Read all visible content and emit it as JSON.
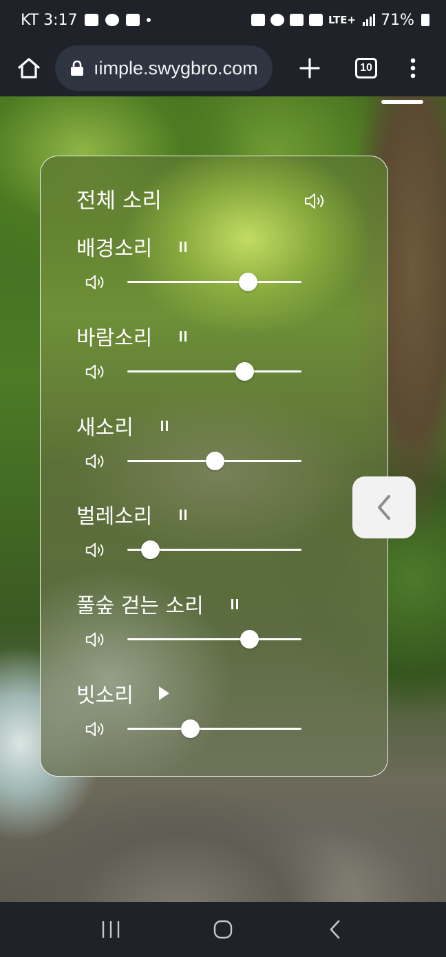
{
  "status_bar": {
    "carrier_time": "KT 3:17",
    "network": "LTE+",
    "battery": "71%"
  },
  "browser": {
    "url": "ıimple.swygbro.com",
    "tab_count": "10"
  },
  "panel": {
    "master_label": "전체 소리",
    "sounds": [
      {
        "name": "배경소리",
        "state": "pause",
        "volume": 0.69
      },
      {
        "name": "바람소리",
        "state": "pause",
        "volume": 0.67
      },
      {
        "name": "새소리",
        "state": "pause",
        "volume": 0.5
      },
      {
        "name": "벌레소리",
        "state": "pause",
        "volume": 0.13
      },
      {
        "name": "풀숲 걷는 소리",
        "state": "pause",
        "volume": 0.7
      },
      {
        "name": "빗소리",
        "state": "play",
        "volume": 0.36
      }
    ]
  },
  "icons": {
    "home": "home-icon",
    "lock": "lock-icon",
    "new_tab": "plus-icon",
    "tabs": "tab-switcher-icon",
    "menu": "more-vert-icon",
    "volume": "volume-icon",
    "pause": "pause-icon",
    "play": "play-icon",
    "collapse": "chevron-left-icon",
    "recents": "recents-icon",
    "nav_home": "home-circle-icon",
    "back": "back-icon"
  },
  "colors": {
    "system_bar": "#1f2329",
    "url_pill": "#2e3540",
    "panel_border": "#ffffff",
    "collapse_button": "#f2f2f2"
  }
}
